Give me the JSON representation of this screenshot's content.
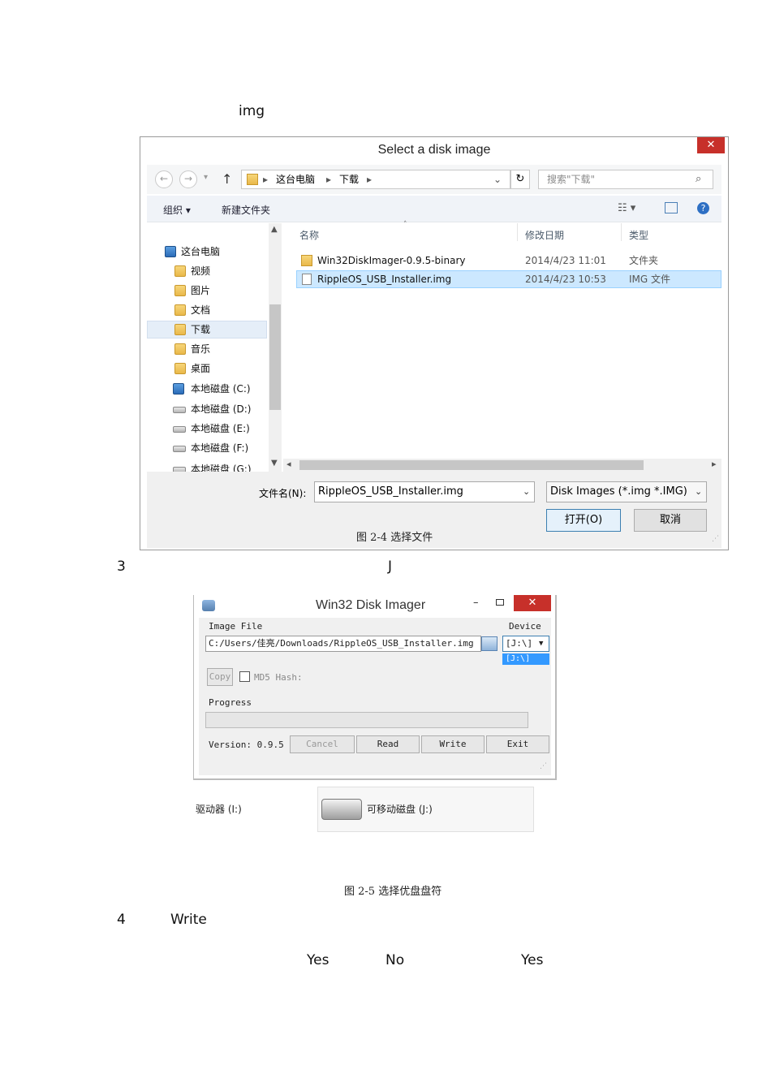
{
  "doc": {
    "line1": "img",
    "step3_num": "3",
    "step3_letter": "J",
    "step4_num": "4",
    "step4_word": "Write",
    "yes1": "Yes",
    "no": "No",
    "yes2": "Yes",
    "caption1": "图 2-4 选择文件",
    "caption2": "图 2-5 选择优盘盘符"
  },
  "file_dialog": {
    "title": "Select a disk image",
    "close": "✕",
    "nav": {
      "back": "←",
      "forward": "→",
      "up": "↑",
      "refresh": "↻"
    },
    "breadcrumb": [
      "这台电脑",
      "下载"
    ],
    "search_placeholder": "搜索\"下载\"",
    "toolbar": {
      "organize": "组织 ▾",
      "new_folder": "新建文件夹"
    },
    "sidebar": [
      {
        "label": "这台电脑",
        "icon": "pc-icon"
      },
      {
        "label": "视频",
        "icon": "folder-icon"
      },
      {
        "label": "图片",
        "icon": "folder-icon"
      },
      {
        "label": "文档",
        "icon": "folder-icon"
      },
      {
        "label": "下载",
        "icon": "folder-icon"
      },
      {
        "label": "音乐",
        "icon": "folder-icon"
      },
      {
        "label": "桌面",
        "icon": "folder-icon"
      },
      {
        "label": "本地磁盘 (C:)",
        "icon": "drive-icon"
      },
      {
        "label": "本地磁盘 (D:)",
        "icon": "drive-icon"
      },
      {
        "label": "本地磁盘 (E:)",
        "icon": "drive-icon"
      },
      {
        "label": "本地磁盘 (F:)",
        "icon": "drive-icon"
      },
      {
        "label": "本地磁盘 (G:)",
        "icon": "drive-icon"
      }
    ],
    "columns": {
      "name": "名称",
      "date": "修改日期",
      "type": "类型"
    },
    "files": [
      {
        "name": "Win32DiskImager-0.9.5-binary",
        "date": "2014/4/23 11:01",
        "type": "文件夹",
        "selected": false
      },
      {
        "name": "RippleOS_USB_Installer.img",
        "date": "2014/4/23 10:53",
        "type": "IMG 文件",
        "selected": true
      }
    ],
    "filename_label": "文件名(N):",
    "filename_value": "RippleOS_USB_Installer.img",
    "filter_value": "Disk Images (*.img *.IMG)",
    "open_label": "打开(O)",
    "cancel_label": "取消"
  },
  "win32": {
    "title": "Win32 Disk Imager",
    "close": "✕",
    "image_file_label": "Image File",
    "device_label": "Device",
    "path_value": "C:/Users/佳亮/Downloads/RippleOS_USB_Installer.img",
    "device_value": "[J:\\]",
    "device_option": "[J:\\]",
    "copy_label": "Copy",
    "md5_label": "MD5 Hash:",
    "progress_label": "Progress",
    "progress": 0,
    "version": "Version: 0.9.5",
    "buttons": {
      "cancel": "Cancel",
      "read": "Read",
      "write": "Write",
      "exit": "Exit"
    }
  },
  "drives": {
    "left_label": "驱动器 (I:)",
    "right_label": "可移动磁盘 (J:)"
  }
}
